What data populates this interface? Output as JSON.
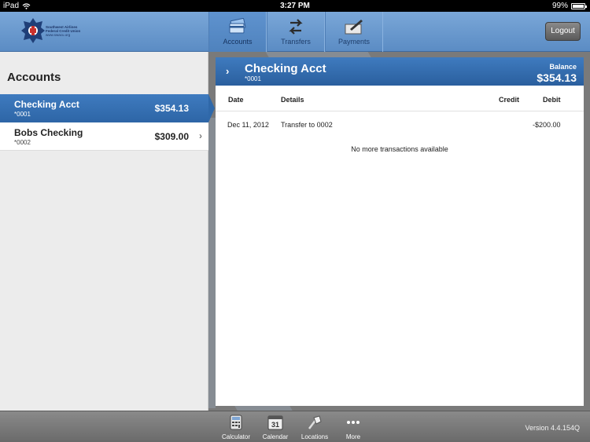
{
  "status_bar": {
    "device": "iPad",
    "time": "3:27 PM",
    "battery": "99%",
    "battery_fraction": 0.99
  },
  "header": {
    "logo": {
      "lines": [
        "Southwest Airlines",
        "Federal Credit Union",
        "www.swacu.org"
      ]
    },
    "tabs": [
      {
        "label": "Accounts",
        "icon": "accounts-card-icon",
        "active": true
      },
      {
        "label": "Transfers",
        "icon": "transfers-arrows-icon",
        "active": false
      },
      {
        "label": "Payments",
        "icon": "payments-pen-icon",
        "active": false
      }
    ],
    "logout_label": "Logout"
  },
  "accounts": {
    "title": "Accounts",
    "items": [
      {
        "name": "Checking Acct",
        "number": "*0001",
        "balance": "$354.13",
        "selected": true
      },
      {
        "name": "Bobs Checking",
        "number": "*0002",
        "balance": "$309.00",
        "selected": false
      }
    ]
  },
  "detail": {
    "name": "Checking Acct",
    "number": "*0001",
    "balance_label": "Balance",
    "balance": "$354.13",
    "columns": {
      "date": "Date",
      "details": "Details",
      "credit": "Credit",
      "debit": "Debit"
    },
    "transactions": [
      {
        "date": "Dec 11, 2012",
        "details": "Transfer to 0002",
        "credit": "",
        "debit": "-$200.00"
      }
    ],
    "no_more": "No more transactions available"
  },
  "bottom_bar": {
    "tools": [
      {
        "label": "Calculator",
        "icon": "calculator-icon"
      },
      {
        "label": "Calendar",
        "icon": "calendar-icon",
        "day": "31"
      },
      {
        "label": "Locations",
        "icon": "locations-icon"
      },
      {
        "label": "More",
        "icon": "more-dots-icon"
      }
    ],
    "version": "Version 4.4.154Q"
  },
  "colors": {
    "header_blue": "#5b8cc4",
    "selected_blue": "#2d65a6",
    "toolbar_gray": "#7a7a7a"
  }
}
